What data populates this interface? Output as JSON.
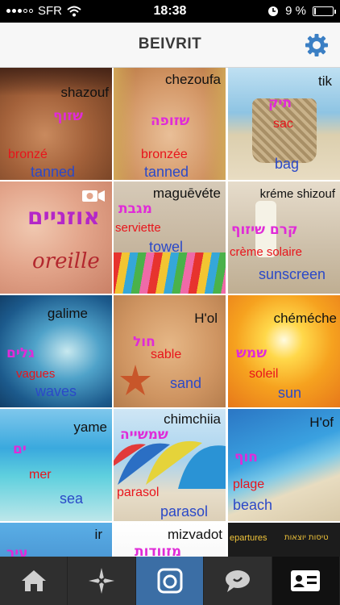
{
  "status_bar": {
    "carrier": "SFR",
    "time": "18:38",
    "battery": "9 %",
    "battery_level": 0.09
  },
  "header": {
    "title": "BEIVRIT",
    "settings_icon": "gear-icon"
  },
  "tiles": [
    {
      "translit": "shazouf",
      "hebrew": "שזוף",
      "french": "bronzé",
      "english": "tanned"
    },
    {
      "translit": "chezoufa",
      "hebrew": "שזופה",
      "french": "bronzée",
      "english": "tanned"
    },
    {
      "translit": "tik",
      "hebrew": "תיק",
      "french": "sac",
      "english": "bag"
    },
    {
      "hebrew": "אוזניים",
      "french": "oreille",
      "video_icon": "video-camera-icon"
    },
    {
      "translit": "maguēvéte",
      "hebrew": "מגבת",
      "french": "serviette",
      "english": "towel"
    },
    {
      "translit": "kréme shizouf",
      "hebrew": "קרם שיזוף",
      "french": "crème solaire",
      "english": "sunscreen"
    },
    {
      "translit": "galime",
      "hebrew": "גלים",
      "french": "vagues",
      "english": "waves"
    },
    {
      "translit": "H'ol",
      "hebrew": "חול",
      "french": "sable",
      "english": "sand"
    },
    {
      "translit": "chéméche",
      "hebrew": "שמש",
      "french": "soleil",
      "english": "sun"
    },
    {
      "translit": "yame",
      "hebrew": "ים",
      "french": "mer",
      "english": "sea"
    },
    {
      "translit": "chimchiia",
      "hebrew": "שמשייה",
      "french": "parasol",
      "english": "parasol"
    },
    {
      "translit": "H'of",
      "hebrew": "חוף",
      "french": "plage",
      "english": "beach"
    },
    {
      "translit": "ir",
      "hebrew": "עיר"
    },
    {
      "translit": "mizvadot",
      "hebrew": "מזוודות"
    },
    {
      "sign_text": "epartures",
      "sign_hebrew": "טיסות יוצאות"
    }
  ],
  "tab_bar": {
    "items": [
      {
        "icon": "home-icon",
        "active": false
      },
      {
        "icon": "explore-star-icon",
        "active": false
      },
      {
        "icon": "camera-icon",
        "active": true
      },
      {
        "icon": "speech-bubble-icon",
        "active": false
      },
      {
        "icon": "profile-card-icon",
        "active": false
      }
    ]
  }
}
